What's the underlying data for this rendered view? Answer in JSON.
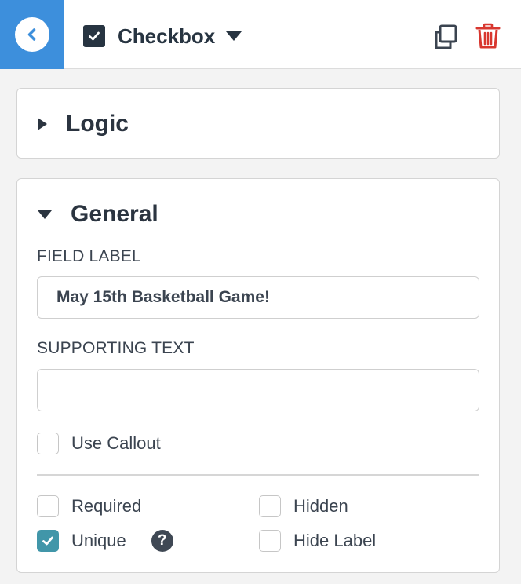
{
  "header": {
    "field_type": "Checkbox",
    "icons": {
      "back": "chevron-left-icon",
      "type": "checkbox-icon",
      "dropdown": "caret-down-icon",
      "duplicate": "duplicate-icon",
      "delete": "trash-icon"
    },
    "colors": {
      "back_bg": "#3d8fdc",
      "delete": "#d8372f"
    }
  },
  "logic_panel": {
    "title": "Logic",
    "expanded": false
  },
  "general_panel": {
    "title": "General",
    "expanded": true,
    "field_label": {
      "label": "FIELD LABEL",
      "value": "May 15th Basketball Game!"
    },
    "supporting_text": {
      "label": "SUPPORTING TEXT",
      "value": ""
    },
    "use_callout": {
      "label": "Use Callout",
      "checked": false
    },
    "options": {
      "required": {
        "label": "Required",
        "checked": false
      },
      "hidden": {
        "label": "Hidden",
        "checked": false
      },
      "unique": {
        "label": "Unique",
        "checked": true,
        "help": "?"
      },
      "hide_label": {
        "label": "Hide Label",
        "checked": false
      }
    },
    "check_color": "#4196a9"
  }
}
